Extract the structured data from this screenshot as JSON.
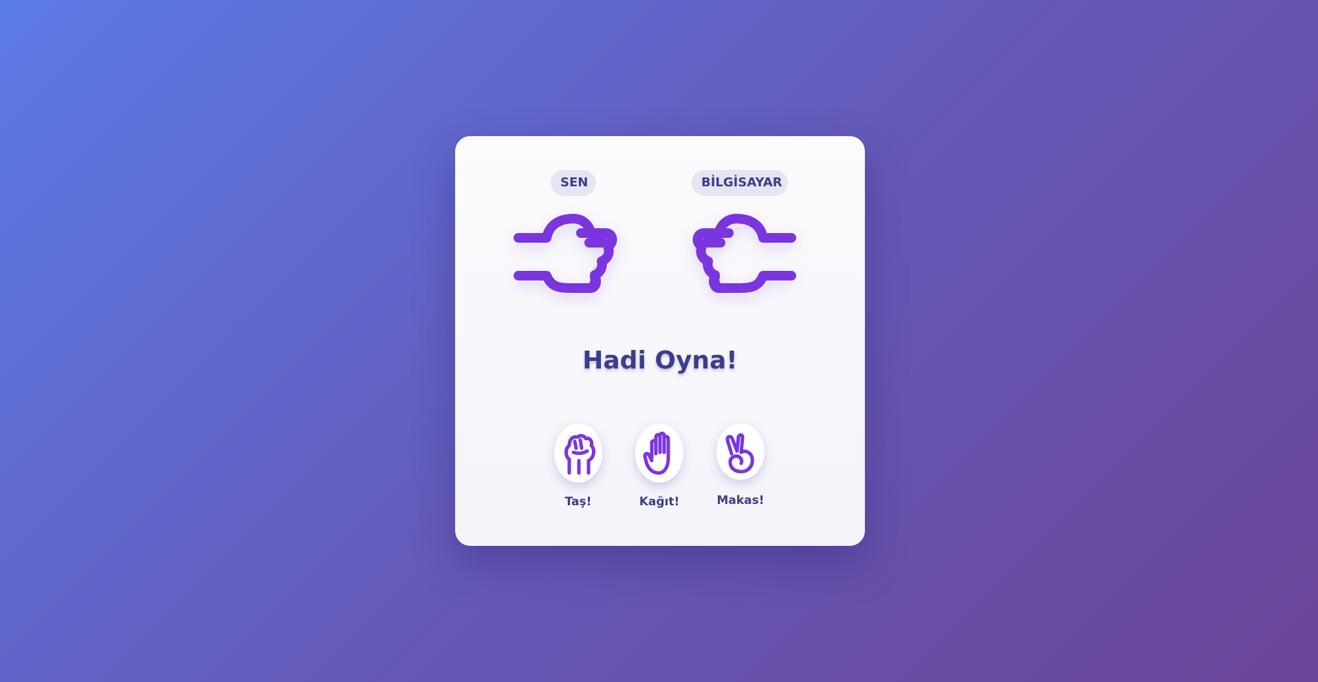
{
  "scoreboard": {
    "player_label": "SEN",
    "computer_label": "BİLGİSAYAR"
  },
  "hands": {
    "player_icon": "fist-icon",
    "computer_icon": "fist-icon"
  },
  "status_text": "Hadi Oyna!",
  "choices": [
    {
      "label": "Taş!",
      "icon": "rock-hand-icon"
    },
    {
      "label": "Kağıt!",
      "icon": "paper-hand-icon"
    },
    {
      "label": "Makas!",
      "icon": "scissors-hand-icon"
    }
  ],
  "colors": {
    "accent": "#7a35de",
    "text": "#3c3d8a",
    "badge_bg": "#e6e5f3",
    "card_bg": "#fbfbfd"
  }
}
